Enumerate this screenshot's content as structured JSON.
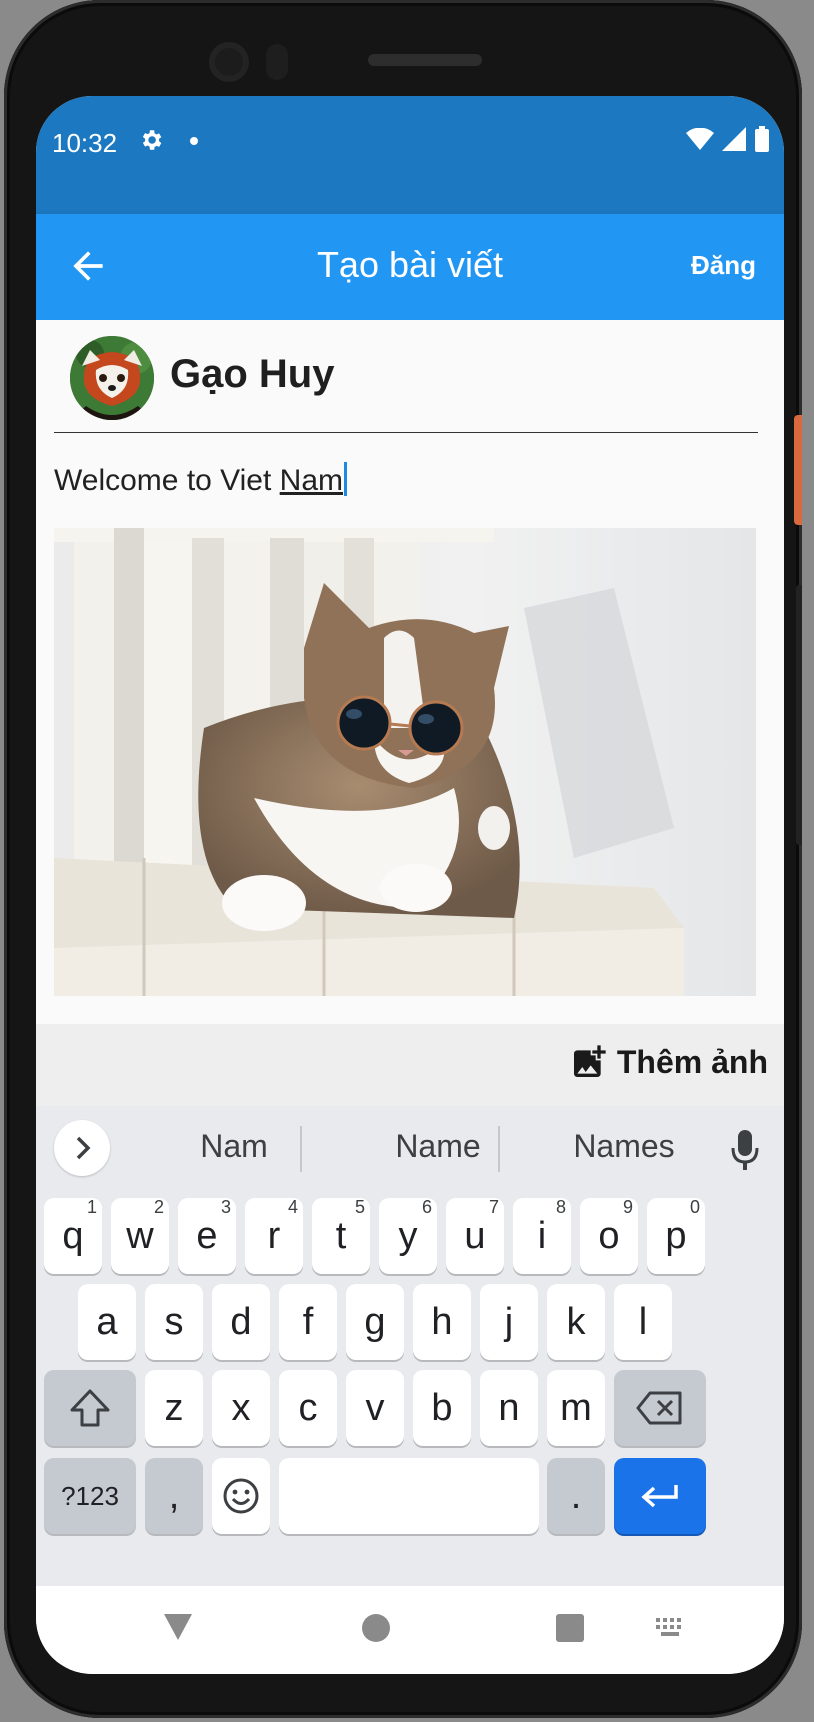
{
  "status": {
    "time": "10:32"
  },
  "appbar": {
    "title": "Tạo bài viết",
    "post_label": "Đăng"
  },
  "user": {
    "name": "Gạo Huy"
  },
  "post": {
    "text_plain": "Welcome to Viet ",
    "text_underlined": "Nam"
  },
  "add_photo": {
    "label": "Thêm ảnh"
  },
  "suggestions": [
    "Nam",
    "Name",
    "Names"
  ],
  "keyboard": {
    "row1": [
      {
        "k": "q",
        "n": "1"
      },
      {
        "k": "w",
        "n": "2"
      },
      {
        "k": "e",
        "n": "3"
      },
      {
        "k": "r",
        "n": "4"
      },
      {
        "k": "t",
        "n": "5"
      },
      {
        "k": "y",
        "n": "6"
      },
      {
        "k": "u",
        "n": "7"
      },
      {
        "k": "i",
        "n": "8"
      },
      {
        "k": "o",
        "n": "9"
      },
      {
        "k": "p",
        "n": "0"
      }
    ],
    "row2": [
      "a",
      "s",
      "d",
      "f",
      "g",
      "h",
      "j",
      "k",
      "l"
    ],
    "row3": [
      "z",
      "x",
      "c",
      "v",
      "b",
      "n",
      "m"
    ],
    "symbols_label": "?123",
    "comma": ",",
    "period": "."
  },
  "colors": {
    "statusbar": "#1c78c0",
    "appbar": "#2196f3",
    "enter": "#1a73e8"
  }
}
